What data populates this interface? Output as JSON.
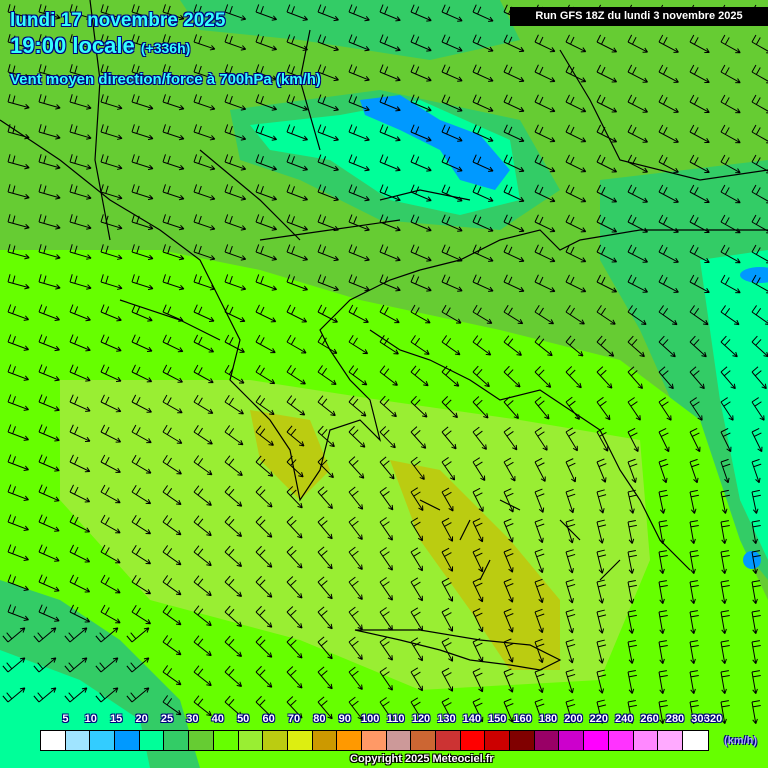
{
  "header": {
    "date": "lundi 17 novembre 2025",
    "time": "19:00 locale",
    "lead": "(+336h)",
    "parameter": "Vent moyen direction/force à 700hPa (km/h)",
    "run": "Run GFS 18Z du lundi 3 novembre 2025"
  },
  "legend": {
    "labels": [
      "5",
      "10",
      "15",
      "20",
      "25",
      "30",
      "40",
      "50",
      "60",
      "70",
      "80",
      "90",
      "100",
      "110",
      "120",
      "130",
      "140",
      "150",
      "160",
      "180",
      "200",
      "220",
      "240",
      "260",
      "280",
      "300",
      "320"
    ],
    "colors": [
      "#ffffff",
      "#a0e4ff",
      "#33ccff",
      "#0099ff",
      "#00ff99",
      "#33cc66",
      "#66cc33",
      "#66ff00",
      "#99ee33",
      "#bbcc11",
      "#ddee11",
      "#cc9900",
      "#ff9900",
      "#ff9966",
      "#cc9999",
      "#cc6633",
      "#cc3333",
      "#ff0000",
      "#cc0000",
      "#800000",
      "#990066",
      "#cc00cc",
      "#ff00ff",
      "#ff33ff",
      "#ff88ff",
      "#ffaaff",
      "#ffffff"
    ],
    "unit": "(km/h)"
  },
  "footer": {
    "copyright": "Copyright 2025 Meteociel.fr"
  }
}
